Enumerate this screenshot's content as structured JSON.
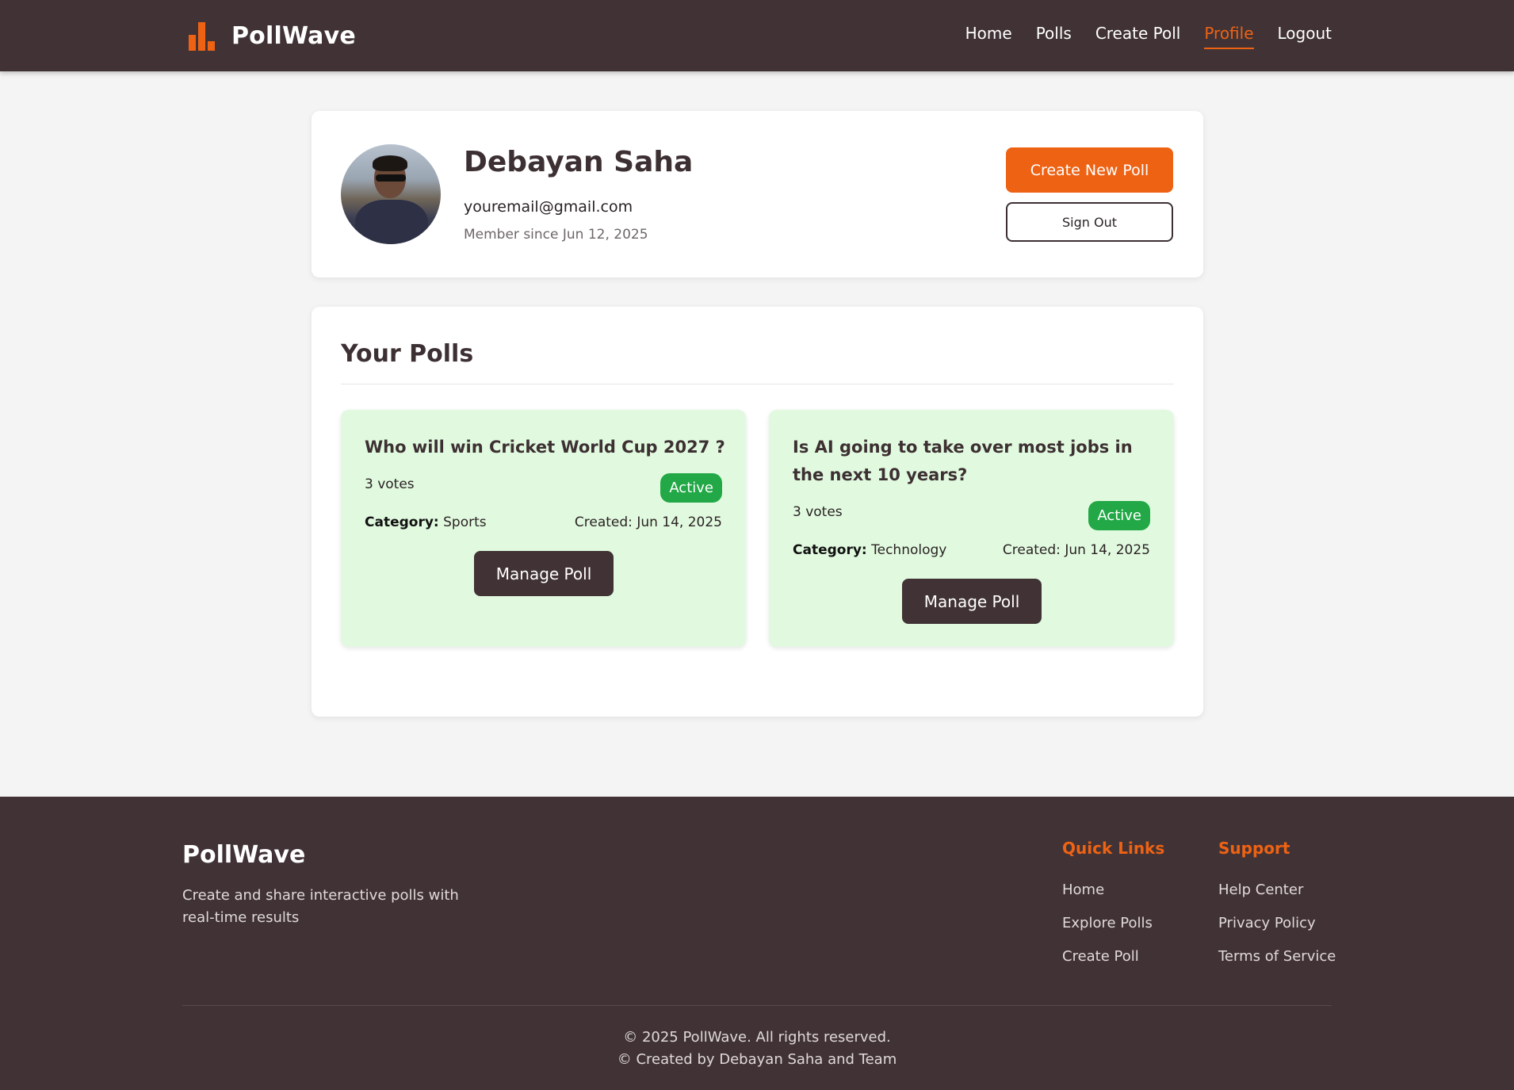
{
  "nav": {
    "brand": "PollWave",
    "links": [
      "Home",
      "Polls",
      "Create Poll",
      "Profile",
      "Logout"
    ],
    "active": "Profile"
  },
  "profile": {
    "name": "Debayan Saha",
    "email": "youremail@gmail.com",
    "member_since": "Member since Jun 12, 2025",
    "create_button": "Create New Poll",
    "signout_button": "Sign Out"
  },
  "polls_section": {
    "title": "Your Polls",
    "polls": [
      {
        "question": "Who will win Cricket World Cup 2027 ?",
        "votes": "3 votes",
        "status": "Active",
        "category_label": "Category:",
        "category": "Sports",
        "created": "Created: Jun 14, 2025",
        "manage_button": "Manage Poll"
      },
      {
        "question": "Is AI going to take over most jobs in the next 10 years?",
        "votes": "3 votes",
        "status": "Active",
        "category_label": "Category:",
        "category": "Technology",
        "created": "Created: Jun 14, 2025",
        "manage_button": "Manage Poll"
      }
    ]
  },
  "footer": {
    "brand": "PollWave",
    "tagline": "Create and share interactive polls with real-time results",
    "quick_links": {
      "title": "Quick Links",
      "items": [
        "Home",
        "Explore Polls",
        "Create Poll"
      ]
    },
    "support": {
      "title": "Support",
      "items": [
        "Help Center",
        "Privacy Policy",
        "Terms of Service"
      ]
    },
    "copyright": "© 2025 PollWave. All rights reserved.",
    "credit": "© Created by Debayan Saha and Team"
  },
  "colors": {
    "accent": "#ee6214",
    "nav_bg": "#413335",
    "poll_card_bg": "#e1fadf",
    "active_badge": "#22a846"
  }
}
